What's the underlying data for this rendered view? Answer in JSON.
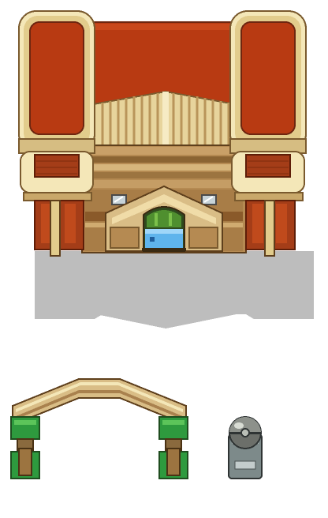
{
  "scene": {
    "sprites": [
      {
        "id": "building",
        "icon": "gym-building-sprite"
      },
      {
        "id": "archway",
        "icon": "wooden-arch-sprite"
      },
      {
        "id": "statue",
        "icon": "pokeball-statue-sprite"
      }
    ]
  },
  "palette": {
    "roof_red": "#b83a12",
    "roof_red_dark": "#8a2a0e",
    "cream": "#f4e7b8",
    "cream_dark": "#c9a86a",
    "wood": "#a9814e",
    "wood_dark": "#6f4d27",
    "brick": "#a43d18",
    "shadow": "#bdbdbd",
    "door_glass": "#5fb4ec",
    "door_green": "#4f8f2f",
    "arch_green": "#2e9a3e",
    "stone_gray": "#7d8a8a"
  }
}
